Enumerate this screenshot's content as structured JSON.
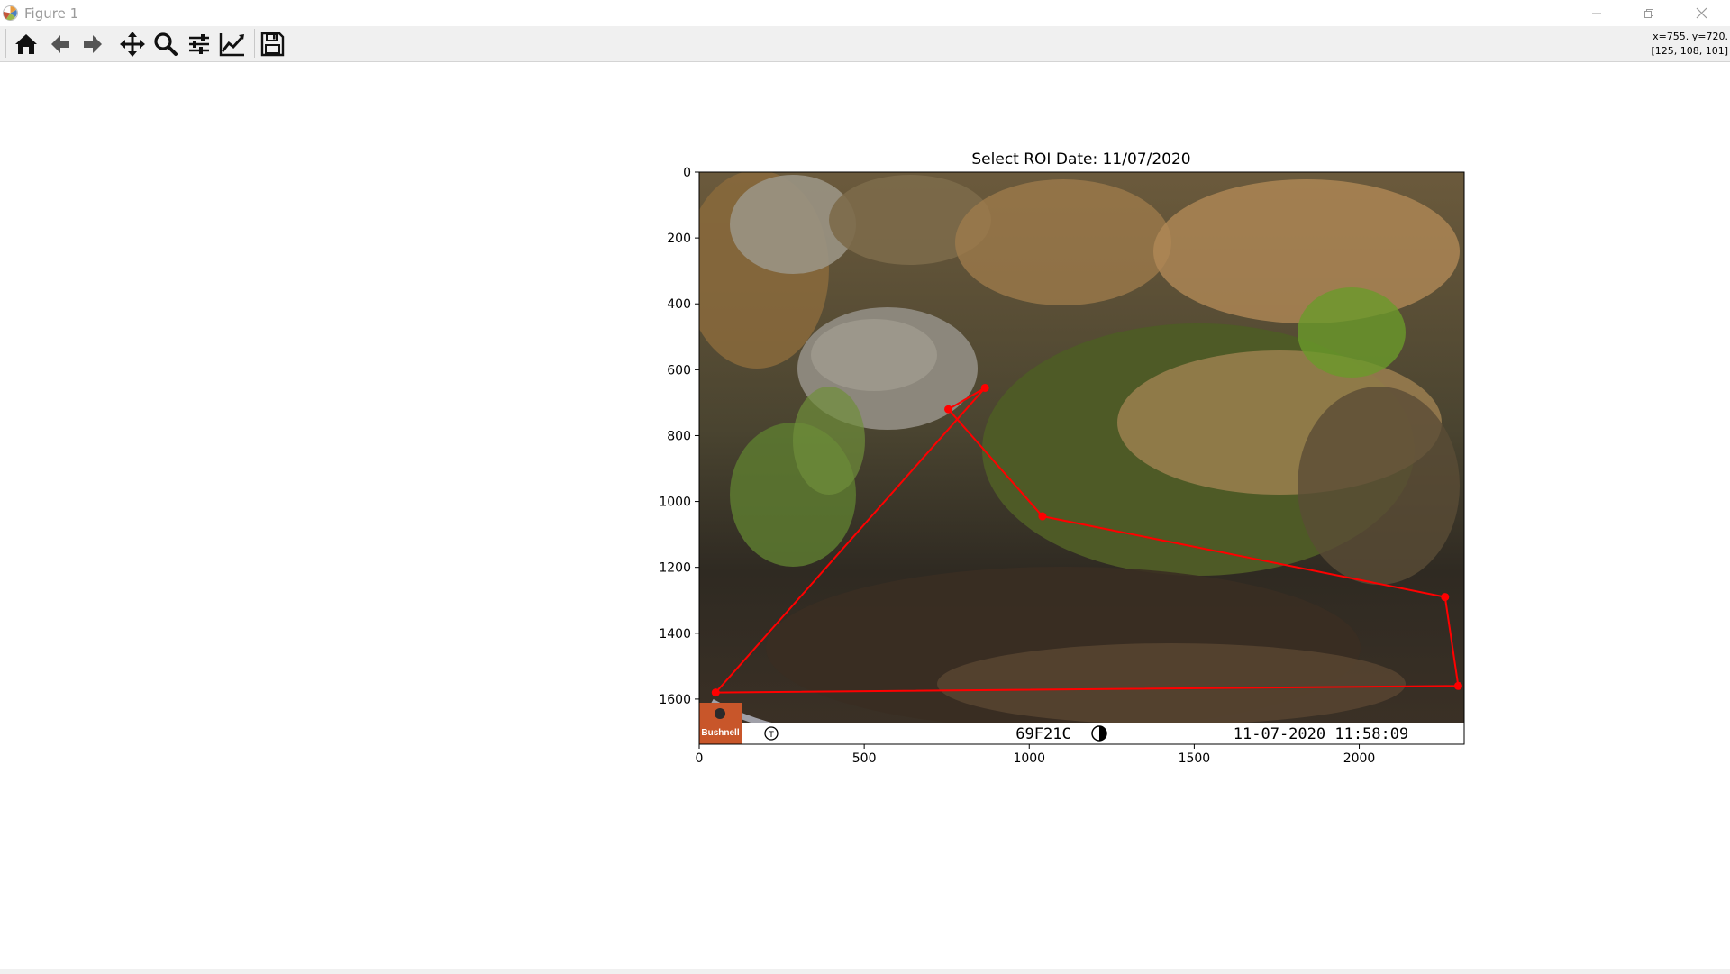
{
  "window": {
    "title": "Figure 1",
    "controls": {
      "minimize_icon": "minimize-icon",
      "restore_icon": "restore-icon",
      "close_icon": "close-icon"
    }
  },
  "toolbar": {
    "buttons": [
      {
        "name": "home",
        "icon": "home-icon"
      },
      {
        "name": "back",
        "icon": "arrow-left-icon"
      },
      {
        "name": "forward",
        "icon": "arrow-right-icon"
      },
      {
        "name": "pan",
        "icon": "move-icon"
      },
      {
        "name": "zoom",
        "icon": "magnifier-icon"
      },
      {
        "name": "subplots",
        "icon": "sliders-icon"
      },
      {
        "name": "edit-axes",
        "icon": "line-chart-icon"
      },
      {
        "name": "save",
        "icon": "floppy-disk-icon"
      }
    ],
    "coords_line1": "x=755. y=720.",
    "coords_line2": "[125, 108, 101]"
  },
  "plot": {
    "title": "Select ROI  Date: 11/07/2020",
    "xlim": [
      0,
      2318
    ],
    "ylim": [
      1737,
      0
    ],
    "xticks": [
      0,
      500,
      1000,
      1500,
      2000
    ],
    "yticks": [
      0,
      200,
      400,
      600,
      800,
      1000,
      1200,
      1400,
      1600
    ],
    "colors": {
      "roi": "#ff0000",
      "footer": "#ffffff",
      "brand": "#c8562a"
    },
    "footer": {
      "brand": "Bushnell",
      "camera_id": "69F21C",
      "datetime": "11-07-2020  11:58:09"
    }
  },
  "chart_data": {
    "type": "line",
    "title": "Select ROI  Date: 11/07/2020",
    "xlabel": "",
    "ylabel": "",
    "xlim": [
      0,
      2318
    ],
    "ylim": [
      1737,
      0
    ],
    "grid": false,
    "series": [
      {
        "x": [
          866,
          755,
          1040,
          2260,
          2300,
          50,
          866
        ],
        "y": [
          655,
          720,
          1045,
          1290,
          1560,
          1580,
          655
        ]
      }
    ]
  }
}
